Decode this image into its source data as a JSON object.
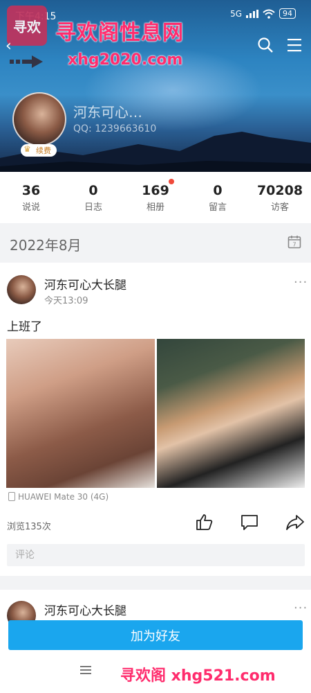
{
  "status": {
    "time": "下午4:15",
    "network": "5G",
    "battery": "94"
  },
  "watermark": {
    "logo_text": "寻欢",
    "title": "寻欢阁性息网",
    "url_top": "xhg2020.com",
    "url_bottom": "寻欢阁 xhg521.com"
  },
  "profile": {
    "nickname": "河东可心…",
    "qq": "QQ: 1239663610",
    "vip_label": "续费"
  },
  "stats": [
    {
      "value": "36",
      "label": "说说"
    },
    {
      "value": "0",
      "label": "日志"
    },
    {
      "value": "169",
      "label": "相册"
    },
    {
      "value": "0",
      "label": "留言"
    },
    {
      "value": "70208",
      "label": "访客"
    }
  ],
  "timeline": {
    "month": "2022年8月"
  },
  "post": {
    "author": "河东可心大长腿",
    "time": "今天13:09",
    "text": "上班了",
    "device": "HUAWEI Mate 30 (4G)",
    "views": "浏览135次",
    "comment_placeholder": "评论"
  },
  "post2": {
    "author": "河东可心大长腿"
  },
  "actions": {
    "add_friend": "加为好友"
  },
  "icons": [
    "back-icon",
    "search-icon",
    "menu-icon",
    "calendar-icon",
    "more-icon",
    "like-icon",
    "comment-icon",
    "share-icon",
    "phone-icon"
  ],
  "colors": {
    "accent": "#1aa6ee",
    "watermark": "#ff2c6d",
    "badge_dot": "#f04a3a"
  }
}
